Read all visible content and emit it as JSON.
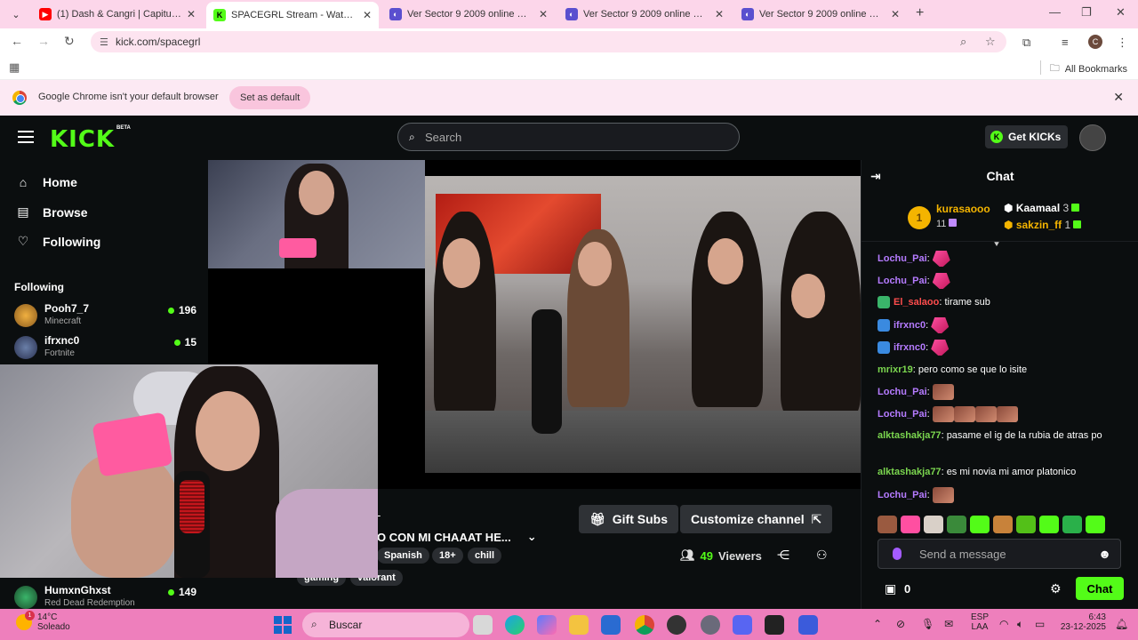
{
  "browser": {
    "tabs": [
      {
        "title": "(1) Dash & Cangri | Capitulo 1 |",
        "favicon": "youtube-icon",
        "color": "#ff0000"
      },
      {
        "title": "SPACEGRL Stream - Watch Live",
        "favicon": "kick-icon",
        "color": "#53fc18",
        "active": true
      },
      {
        "title": "Ver Sector 9 2009 online HD - C",
        "favicon": "site-icon",
        "color": "#5a4fcf"
      },
      {
        "title": "Ver Sector 9 2009 online HD - C",
        "favicon": "site-icon",
        "color": "#5a4fcf"
      },
      {
        "title": "Ver Sector 9 2009 online HD - C",
        "favicon": "site-icon",
        "color": "#5a4fcf"
      }
    ],
    "url": "kick.com/spacegrl",
    "profile_initial": "C",
    "all_bookmarks": "All Bookmarks",
    "infobar": {
      "message": "Google Chrome isn't your default browser",
      "button": "Set as default"
    }
  },
  "kick": {
    "logo": "KICK",
    "beta": "BETA",
    "search_placeholder": "Search",
    "get_kicks": "Get KICKs",
    "accent": "#53fc18"
  },
  "sidebar": {
    "nav": [
      {
        "label": "Home",
        "icon": "home-icon"
      },
      {
        "label": "Browse",
        "icon": "browse-icon"
      },
      {
        "label": "Following",
        "icon": "heart-icon"
      }
    ],
    "following_heading": "Following",
    "channels": [
      {
        "name": "Pooh7_7",
        "game": "Minecraft",
        "viewers": "196"
      },
      {
        "name": "ifrxnc0",
        "game": "Fortnite",
        "viewers": "15"
      },
      {
        "name": "HumxnGhxst",
        "game": "Red Dead Redemption",
        "viewers": "149"
      }
    ]
  },
  "stream": {
    "title_fragment": "O CON MI CHAAAT HE...",
    "dash": "-",
    "tags": [
      "Spanish",
      "18+",
      "chill",
      "gaming",
      "valorant"
    ],
    "gift_subs": "Gift Subs",
    "customize": "Customize channel",
    "viewers_count": "49",
    "viewers_label": "Viewers"
  },
  "chat": {
    "title": "Chat",
    "leaderboard": {
      "first": {
        "name": "kurasaooo",
        "count": "11",
        "rank": "1"
      },
      "second": {
        "name": "Kaamaal",
        "count": "3"
      },
      "third": {
        "name": "sakzin_ff",
        "count": "1"
      }
    },
    "messages": [
      {
        "user": "Lochu_Pai",
        "color": "#b57bff",
        "text": "",
        "emotes": [
          "ribbon"
        ]
      },
      {
        "user": "Lochu_Pai",
        "color": "#b57bff",
        "text": "",
        "emotes": [
          "ribbon"
        ]
      },
      {
        "user": "El_salaoo",
        "color": "#ff4d4d",
        "text": "tirame sub",
        "emotes": []
      },
      {
        "user": "ifrxnc0",
        "color": "#b57bff",
        "text": "",
        "emotes": [
          "ribbon"
        ]
      },
      {
        "user": "ifrxnc0",
        "color": "#b57bff",
        "text": "",
        "emotes": [
          "ribbon"
        ]
      },
      {
        "user": "mrixr19",
        "color": "#7bd64f",
        "text": "pero como se que lo isite",
        "emotes": []
      },
      {
        "user": "Lochu_Pai",
        "color": "#b57bff",
        "text": "",
        "emotes": [
          "pic"
        ]
      },
      {
        "user": "Lochu_Pai",
        "color": "#b57bff",
        "text": "",
        "emotes": [
          "pic",
          "pic",
          "pic",
          "pic"
        ]
      },
      {
        "user": "alktashakja77",
        "color": "#7bd64f",
        "text": "pasame el ig de la rubia de atras po",
        "emotes": []
      },
      {
        "user": "alktashakja77",
        "color": "#7bd64f",
        "text": "es mi novia mi amor platonico",
        "emotes": []
      },
      {
        "user": "Lochu_Pai",
        "color": "#b57bff",
        "text": "",
        "emotes": [
          "pic"
        ]
      }
    ],
    "input_placeholder": "Send a message",
    "kicks_count": "0",
    "send_button": "Chat"
  },
  "taskbar": {
    "temperature": "14°C",
    "weather": "Soleado",
    "search_placeholder": "Buscar",
    "lang": "ESP",
    "region": "LAA",
    "time": "6:43",
    "date": "23-12-2025"
  }
}
